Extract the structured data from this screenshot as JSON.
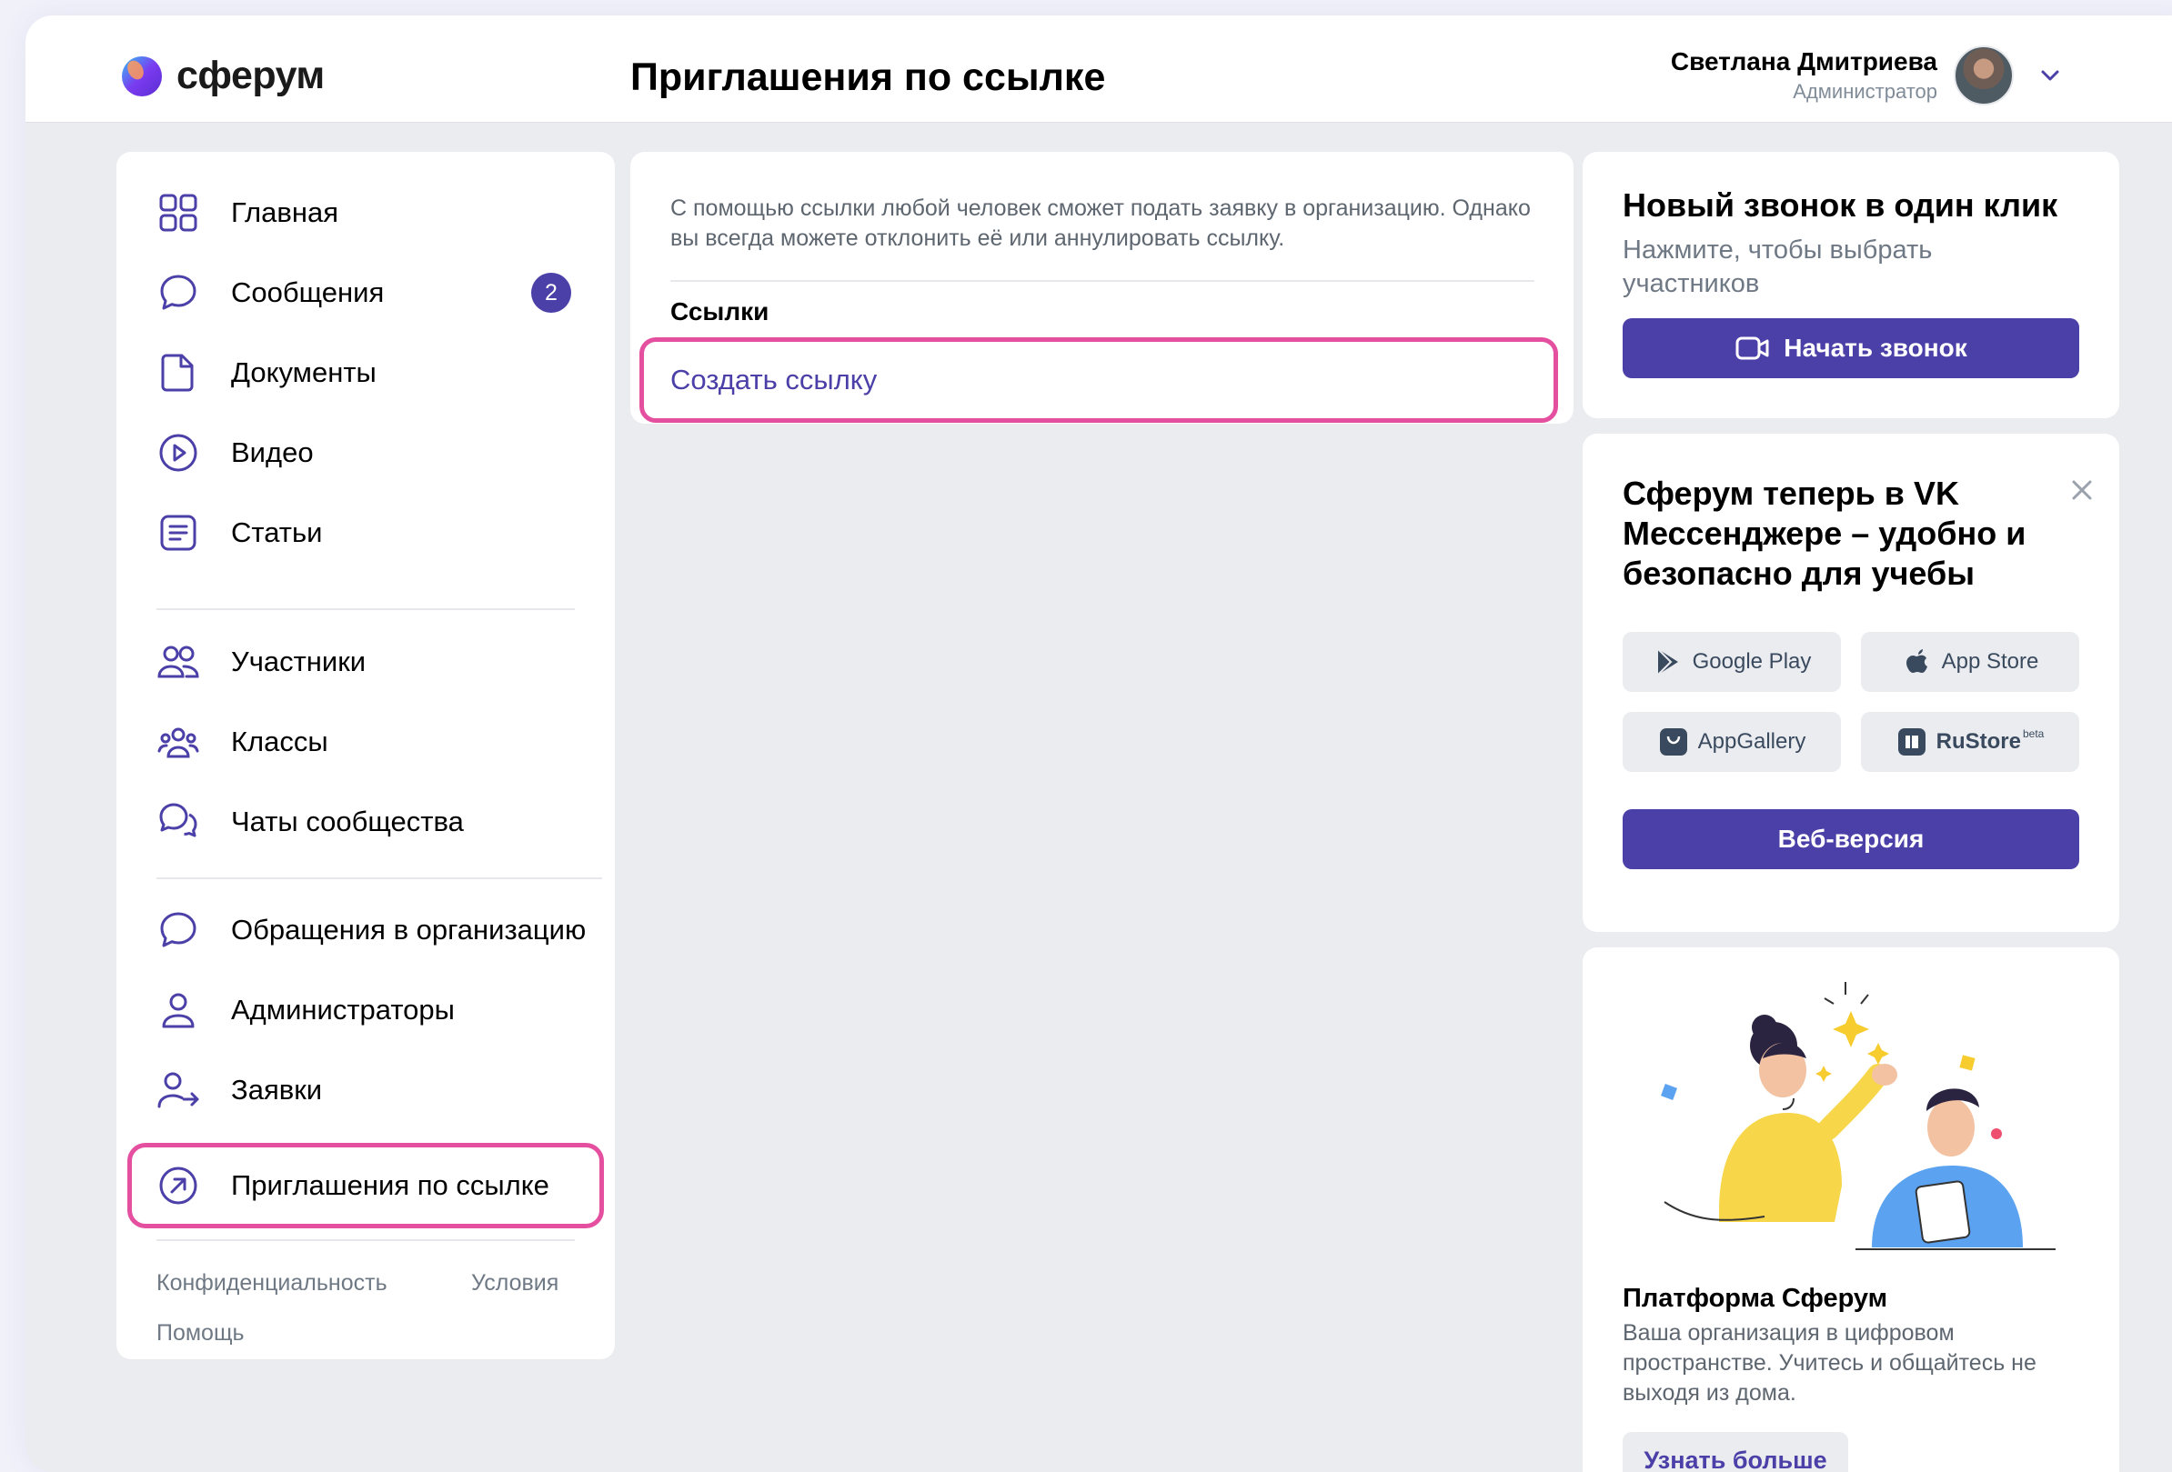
{
  "app": {
    "logo_text": "сферум",
    "page_title": "Приглашения по ссылке"
  },
  "user": {
    "name": "Светлана Дмитриева",
    "role": "Администратор"
  },
  "sidebar": {
    "items": [
      {
        "label": "Главная",
        "icon": "grid-icon"
      },
      {
        "label": "Сообщения",
        "icon": "chat-bubble-icon",
        "badge": "2"
      },
      {
        "label": "Документы",
        "icon": "document-icon"
      },
      {
        "label": "Видео",
        "icon": "play-circle-icon"
      },
      {
        "label": "Статьи",
        "icon": "article-icon"
      },
      {
        "label": "Участники",
        "icon": "users-icon"
      },
      {
        "label": "Классы",
        "icon": "group-icon"
      },
      {
        "label": "Чаты сообщества",
        "icon": "community-chats-icon"
      },
      {
        "label": "Обращения в организацию",
        "icon": "chat-bubble-icon"
      },
      {
        "label": "Администраторы",
        "icon": "user-icon"
      },
      {
        "label": "Заявки",
        "icon": "user-arrow-icon"
      },
      {
        "label": "Приглашения по ссылке",
        "icon": "link-arrow-icon",
        "active": true
      }
    ],
    "footer": {
      "privacy": "Конфиденциальность",
      "terms": "Условия",
      "help": "Помощь"
    }
  },
  "invites": {
    "info": "С помощью ссылки любой человек сможет подать заявку в организацию. Однако вы всегда можете отклонить её или аннулировать ссылку.",
    "links_heading": "Ссылки",
    "create_link": "Создать ссылку"
  },
  "call_card": {
    "title": "Новый звонок в один клик",
    "subtitle": "Нажмите, чтобы выбрать участников",
    "button": "Начать звонок"
  },
  "vk_card": {
    "title": "Сферум теперь в VK Мессенджере – удобно и безопасно для учебы",
    "stores": [
      "Google Play",
      "App Store",
      "AppGallery",
      "RuStore"
    ],
    "rustore_badge": "beta",
    "web_button": "Веб-версия"
  },
  "promo_card": {
    "title": "Платформа Сферум",
    "text": "Ваша организация в цифровом пространстве. Учитесь и общайтесь не выходя из дома.",
    "button": "Узнать больше"
  },
  "colors": {
    "accent": "#4b3fa8",
    "highlight": "#e54fa0",
    "background": "#ebecf0"
  }
}
